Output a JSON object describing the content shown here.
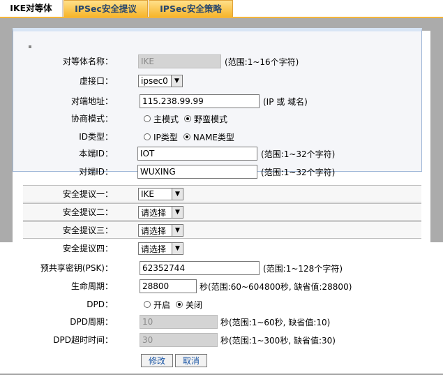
{
  "tabs": [
    {
      "label": "IKE对等体",
      "active": true
    },
    {
      "label": "IPSec安全提议",
      "active": false
    },
    {
      "label": "IPSec安全策略",
      "active": false
    }
  ],
  "form": {
    "peer_name": {
      "label": "对等体名称：",
      "value": "IKE",
      "hint": "(范围:1~16个字符)"
    },
    "virtual_interface": {
      "label": "虚接口：",
      "value": "ipsec0"
    },
    "remote_address": {
      "label": "对端地址：",
      "value": "115.238.99.99",
      "hint": "(IP 或 域名)"
    },
    "negotiation_mode": {
      "label": "协商模式：",
      "options": [
        "主模式",
        "野蛮模式"
      ],
      "selected": "野蛮模式"
    },
    "id_type": {
      "label": "ID类型：",
      "options": [
        "IP类型",
        "NAME类型"
      ],
      "selected": "NAME类型"
    },
    "local_id": {
      "label": "本端ID：",
      "value": "IOT",
      "hint": "(范围:1~32个字符)"
    },
    "remote_id": {
      "label": "对端ID：",
      "value": "WUXING",
      "hint": "(范围:1~32个字符)"
    },
    "proposal_1": {
      "label": "安全提议一：",
      "value": "IKE"
    },
    "proposal_2": {
      "label": "安全提议二：",
      "value": "请选择"
    },
    "proposal_3": {
      "label": "安全提议三：",
      "value": "请选择"
    },
    "proposal_4": {
      "label": "安全提议四：",
      "value": "请选择"
    },
    "psk": {
      "label": "预共享密钥(PSK)：",
      "value": "62352744",
      "hint": "(范围:1~128个字符)"
    },
    "lifetime": {
      "label": "生命周期：",
      "value": "28800",
      "hint": "秒(范围:60~604800秒, 缺省值:28800)"
    },
    "dpd": {
      "label": "DPD：",
      "options": [
        "开启",
        "关闭"
      ],
      "selected": "关闭"
    },
    "dpd_period": {
      "label": "DPD周期：",
      "value": "10",
      "hint": "秒(范围:1~60秒, 缺省值:10)"
    },
    "dpd_timeout": {
      "label": "DPD超时时间：",
      "value": "30",
      "hint": "秒(范围:1~300秒, 缺省值:30)"
    }
  },
  "buttons": {
    "modify": "修改",
    "cancel": "取消"
  }
}
